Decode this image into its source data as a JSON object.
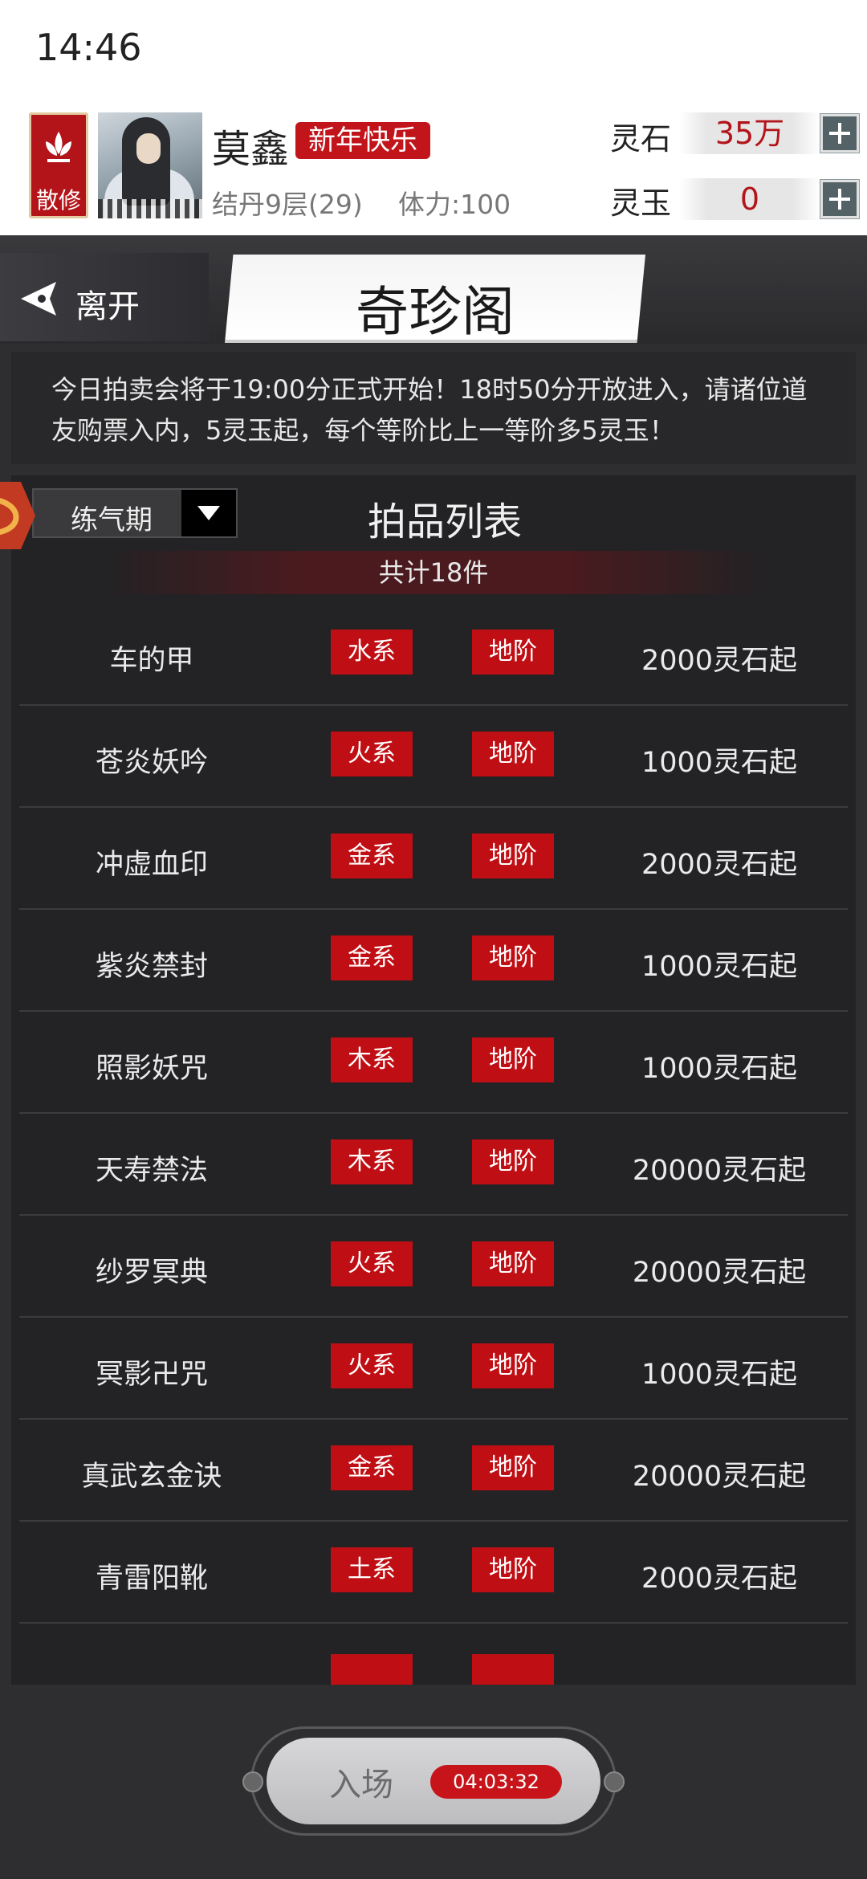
{
  "status": {
    "time": "14:46"
  },
  "player": {
    "sect": "散修",
    "name": "莫鑫",
    "title_badge": "新年快乐",
    "realm": "结丹9层(29)",
    "stamina": "体力:100"
  },
  "currency": {
    "spirit_stone_label": "灵石",
    "spirit_stone_value": "35万",
    "spirit_jade_label": "灵玉",
    "spirit_jade_value": "0"
  },
  "nav": {
    "leave_label": "离开",
    "page_title": "奇珍阁"
  },
  "notice": "今日拍卖会将于19:00分正式开始！18时50分开放进入，请诸位道友购票入内，5灵玉起，每个等阶比上一等阶多5灵玉！",
  "filter": {
    "selected": "练气期"
  },
  "list": {
    "title": "拍品列表",
    "count": "共计18件",
    "items": [
      {
        "name": "车的甲",
        "element": "水系",
        "grade": "地阶",
        "price": "2000灵石起"
      },
      {
        "name": "苍炎妖吟",
        "element": "火系",
        "grade": "地阶",
        "price": "1000灵石起"
      },
      {
        "name": "冲虚血印",
        "element": "金系",
        "grade": "地阶",
        "price": "2000灵石起"
      },
      {
        "name": "紫炎禁封",
        "element": "金系",
        "grade": "地阶",
        "price": "1000灵石起"
      },
      {
        "name": "照影妖咒",
        "element": "木系",
        "grade": "地阶",
        "price": "1000灵石起"
      },
      {
        "name": "天寿禁法",
        "element": "木系",
        "grade": "地阶",
        "price": "20000灵石起"
      },
      {
        "name": "纱罗冥典",
        "element": "火系",
        "grade": "地阶",
        "price": "20000灵石起"
      },
      {
        "name": "冥影卍咒",
        "element": "火系",
        "grade": "地阶",
        "price": "1000灵石起"
      },
      {
        "name": "真武玄金诀",
        "element": "金系",
        "grade": "地阶",
        "price": "20000灵石起"
      },
      {
        "name": "青雷阳靴",
        "element": "土系",
        "grade": "地阶",
        "price": "2000灵石起"
      }
    ]
  },
  "enter": {
    "label": "入场",
    "timer": "04:03:32"
  },
  "colors": {
    "accent_red": "#c00f14",
    "background": "#2e2d30",
    "panel": "#232225"
  }
}
